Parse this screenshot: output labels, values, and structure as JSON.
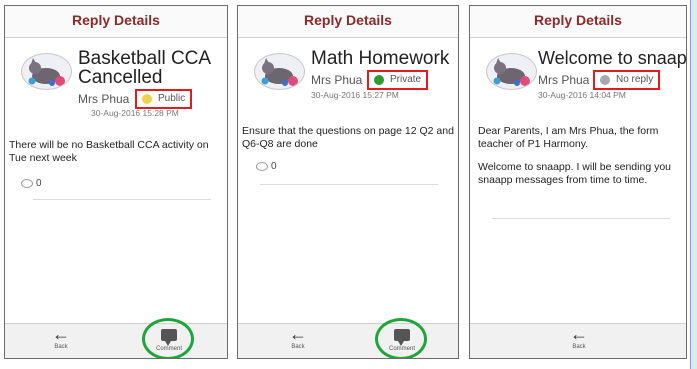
{
  "screens": [
    {
      "header": "Reply Details",
      "title": "Basketball CCA Cancelled",
      "author": "Mrs Phua",
      "visibility": "Public",
      "visibility_color": "#f0d24a",
      "date": "30-Aug-2016  15:28 PM",
      "body": [
        "There will be no Basketball CCA activity on Tue next week"
      ],
      "comment_count": "0",
      "back_label": "Back",
      "comment_label": "Comment"
    },
    {
      "header": "Reply Details",
      "title": "Math Homework",
      "author": "Mrs Phua",
      "visibility": "Private",
      "visibility_color": "#2f9a2f",
      "date": "30-Aug-2016  15:27 PM",
      "body": [
        "Ensure that the questions on page 12 Q2 and Q6-Q8 are done"
      ],
      "comment_count": "0",
      "back_label": "Back",
      "comment_label": "Comment"
    },
    {
      "header": "Reply Details",
      "title": "Welcome to snaapp",
      "author": "Mrs Phua",
      "visibility": "No reply",
      "visibility_color": "#a8a8a8",
      "date": "30-Aug-2016  14:04 PM",
      "body": [
        "Dear Parents, I am Mrs Phua, the form teacher of P1 Harmony.",
        "Welcome to snaapp. I will be sending you snaapp messages from time to time."
      ],
      "back_label": "Back"
    }
  ]
}
